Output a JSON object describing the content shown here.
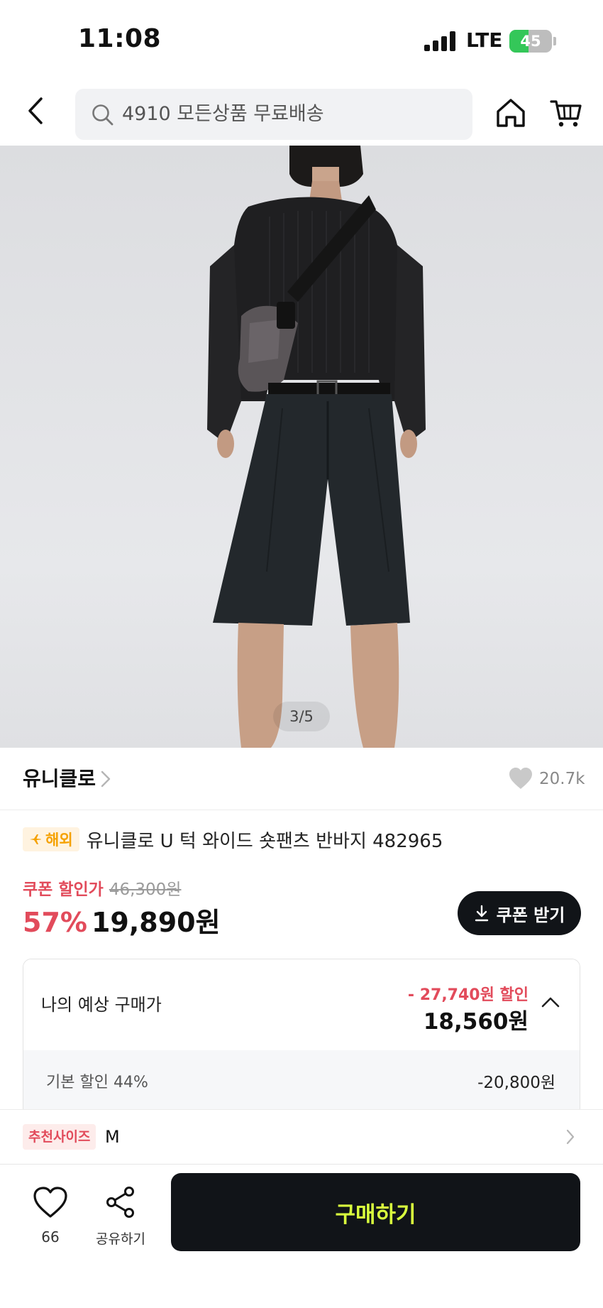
{
  "status_bar": {
    "time": "11:08",
    "network": "LTE",
    "battery": "45",
    "battery_level": 0.45
  },
  "search": {
    "text": "4910 모든상품 무료배송"
  },
  "product_image": {
    "counter": "3/5"
  },
  "brand": {
    "name": "유니클로",
    "likes": "20.7k"
  },
  "product": {
    "badge": "해외",
    "title": "유니클로 U 턱 와이드 숏팬츠 반바지 482965"
  },
  "price": {
    "coupon_label": "쿠폰 할인가",
    "original": "46,300원",
    "discount_rate": "57%",
    "sale": "19,890원",
    "coupon_button": "쿠폰 받기"
  },
  "expected": {
    "label": "나의 예상 구매가",
    "discount": "- 27,740원 할인",
    "price": "18,560원",
    "detail_label": "기본 할인 44%",
    "detail_value": "-20,800원"
  },
  "size": {
    "badge": "추천사이즈",
    "value": "M"
  },
  "bottom_bar": {
    "wish_count": "66",
    "share_label": "공유하기",
    "buy_label": "구매하기"
  },
  "colors": {
    "accent_red": "#e24b5b",
    "buy_text": "#d9ff3d",
    "dark": "#111418"
  }
}
